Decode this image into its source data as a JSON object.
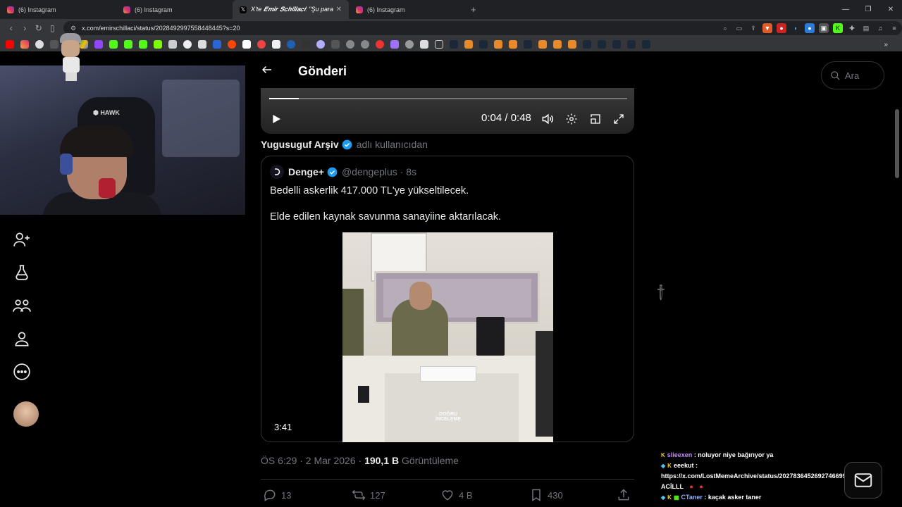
{
  "browser": {
    "tabs": [
      {
        "label": "(6) Instagram",
        "icon": "instagram-icon",
        "active": false
      },
      {
        "label": "(6) Instagram",
        "icon": "instagram-icon",
        "active": false
      },
      {
        "label": "X'te 𝑬𝒎𝒊𝒓 𝑺𝒄𝒉𝒊𝒍𝒍𝒂𝒄𝒊: \"Şu para",
        "icon": "x-icon",
        "active": true
      },
      {
        "label": "(6) Instagram",
        "icon": "instagram-icon",
        "active": false
      }
    ],
    "new_tab": "+",
    "url": "x.com/emirschillaci/status/2028492997558448445?s=20"
  },
  "header": {
    "title": "Gönderi",
    "search_placeholder": "Ara"
  },
  "video": {
    "time": "0:04 / 0:48",
    "progress": 0.083
  },
  "retweet": {
    "name": "Yugusuguf Arşiv",
    "suffix": "adlı kullanıcıdan"
  },
  "quote": {
    "name": "Denge+",
    "handle": "@dengeplus · 8s",
    "text_1": "Bedelli askerlik 417.000 TL'ye yükseltilecek.",
    "text_2": "Elde edilen kaynak savunma sanayiine aktarılacak.",
    "duration": "3:41",
    "watermark": "DOĞRU\nİNCELEME"
  },
  "meta": {
    "time": "ÖS 6:29 · 2 Mar 2026 · ",
    "views": "190,1 B",
    "views_label": " Görüntüleme"
  },
  "actions": {
    "replies": "13",
    "reposts": "127",
    "likes": "4 B",
    "bookmarks": "430"
  },
  "chat": {
    "messages": [
      {
        "user": "slieexen",
        "user_color": "#c78cff",
        "text": " : noluyor niye bağırıyor ya"
      },
      {
        "user": "eeekut",
        "user_color": "#ffffff",
        "text": " :"
      },
      {
        "user": "",
        "user_color": "#ffffff",
        "text": "https://x.com/LostMemeArchive/status/2027836452692746699 ÇOK"
      },
      {
        "user": "",
        "user_color": "#ffffff",
        "text": "ACİLLL"
      },
      {
        "user": "CTaner",
        "user_color": "#8fb0ff",
        "text": " : kaçak asker taner"
      }
    ]
  },
  "colors": {
    "verified": "#1d9bf0",
    "muted": "#71767b",
    "border": "#2f3336"
  }
}
